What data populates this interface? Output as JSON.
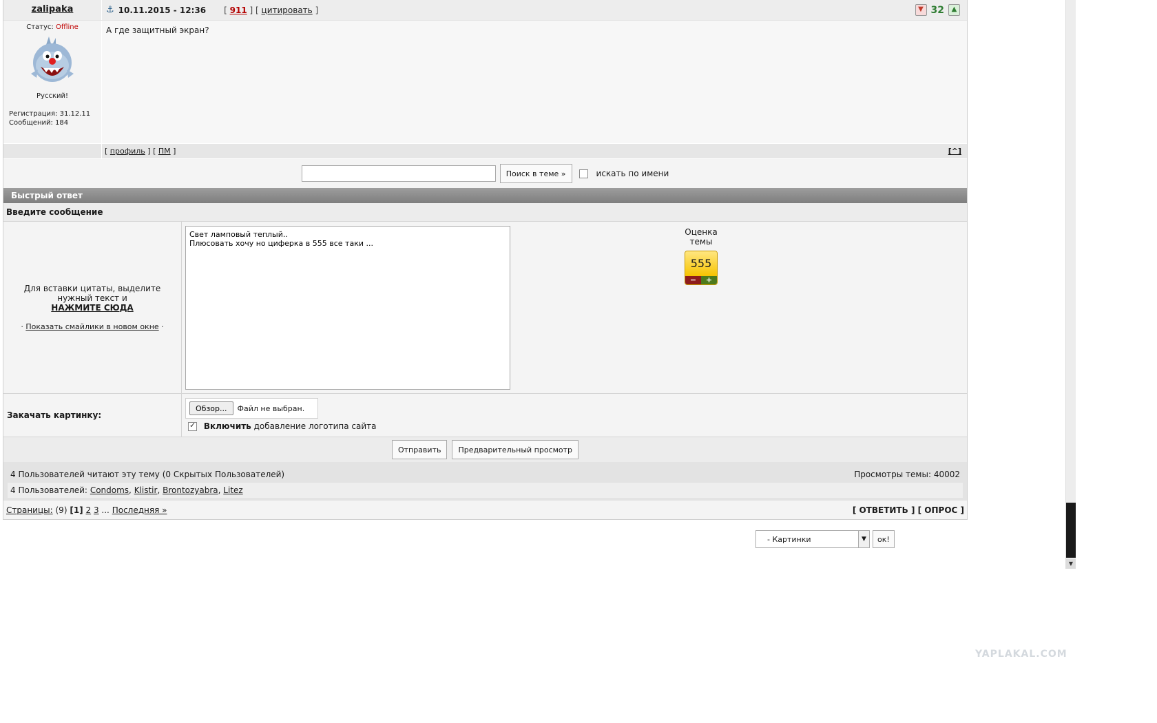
{
  "post": {
    "author": "zalipaka",
    "date": "10.11.2015 - 12:36",
    "bracket_open": "[",
    "karma_link": "911",
    "separator": "] [",
    "quote_link": "цитировать",
    "bracket_close": "]",
    "rating": "32",
    "status_label": "Статус:",
    "status_value": "Offline",
    "author_title": "Русский!",
    "registration": "Регистрация: 31.12.11",
    "messages": "Сообщений: 184",
    "text": "А где защитный экран?",
    "profile_link": "профиль",
    "pm_link": "ПМ",
    "top_link": "[^]"
  },
  "search": {
    "button": "Поиск в теме »",
    "by_name_label": "искать по имени"
  },
  "quick_reply": {
    "header": "Быстрый ответ",
    "subheader": "Введите сообщение",
    "quote_hint": "Для вставки цитаты, выделите нужный текст и",
    "press_here": "НАЖМИТЕ СЮДА",
    "smiles_link": "Показать смайлики в новом окне",
    "message": "Свет ламповый теплый..\nПлюсовать хочу но циферка в 555 все таки ...",
    "topic_rating_label": "Оценка темы",
    "topic_rating_value": "555",
    "rating_minus": "−",
    "rating_plus": "+",
    "upload_label": "Закачать картинку:",
    "browse_button": "Обзор...",
    "file_status": "Файл не выбран.",
    "logo_strong": "Включить",
    "logo_rest": "добавление логотипа сайта",
    "send_button": "Отправить",
    "preview_button": "Предварительный просмотр"
  },
  "stats": {
    "readers_summary": "4 Пользователей читают эту тему (0 Скрытых Пользователей)",
    "views": "Просмотры темы: 40002",
    "users_prefix": "4 Пользователей:",
    "users": [
      "Condoms",
      "Klistir",
      "Brontozyabra",
      "Litez"
    ]
  },
  "pagination": {
    "label": "Страницы:",
    "total": "(9)",
    "current": "[1]",
    "p2": "2",
    "p3": "3",
    "ellipsis": "...",
    "last": "Последняя »",
    "reply": "[ ОТВЕТИТЬ ]",
    "poll": "[ ОПРОС ]"
  },
  "jump": {
    "selected": "- Картинки",
    "ok": "ок!"
  },
  "watermark": "YAPLAKAL.COM",
  "colors": {
    "header_gray": "#8a8a8a",
    "rating_green": "#2f7d32",
    "karma_red": "#b30000",
    "status_red": "#c00000"
  },
  "icons": [
    "anchor-icon",
    "vote-minus-icon",
    "vote-plus-icon",
    "avatar-image",
    "dropdown-arrow-icon"
  ]
}
